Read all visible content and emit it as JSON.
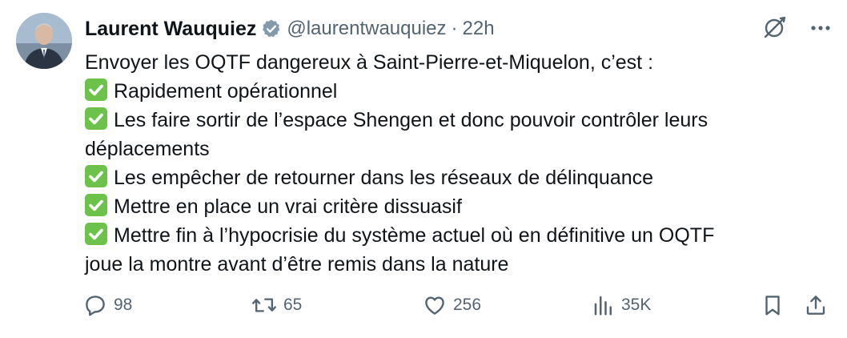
{
  "author": {
    "name": "Laurent Wauquiez",
    "handle": "@laurentwauquiez",
    "separator": "·",
    "time": "22h"
  },
  "tweet": {
    "intro": "Envoyer les OQTF dangereux à Saint-Pierre-et-Miquelon, c’est :",
    "items": [
      [
        "Rapidement opérationnel"
      ],
      [
        "Les faire sortir de l’espace Shengen et donc pouvoir contrôler leurs",
        "déplacements"
      ],
      [
        "Les empêcher de retourner dans les réseaux de délinquance"
      ],
      [
        "Mettre en place un vrai critère dissuasif"
      ],
      [
        "Mettre fin à l’hypocrisie du système actuel où en définitive un OQTF",
        "joue la montre avant d’être remis dans la nature"
      ]
    ]
  },
  "stats": {
    "replies": "98",
    "reposts": "65",
    "likes": "256",
    "views": "35K"
  },
  "colors": {
    "text": "#0f1419",
    "muted": "#536471",
    "check_green": "#6cc24a",
    "verified_gray": "#829aab"
  },
  "icons": {
    "verified": "verified-badge-icon",
    "grok": "grok-icon",
    "more": "more-icon",
    "reply": "reply-icon",
    "repost": "repost-icon",
    "like": "like-icon",
    "views": "views-icon",
    "bookmark": "bookmark-icon",
    "share": "share-icon",
    "check": "check-mark-icon"
  }
}
